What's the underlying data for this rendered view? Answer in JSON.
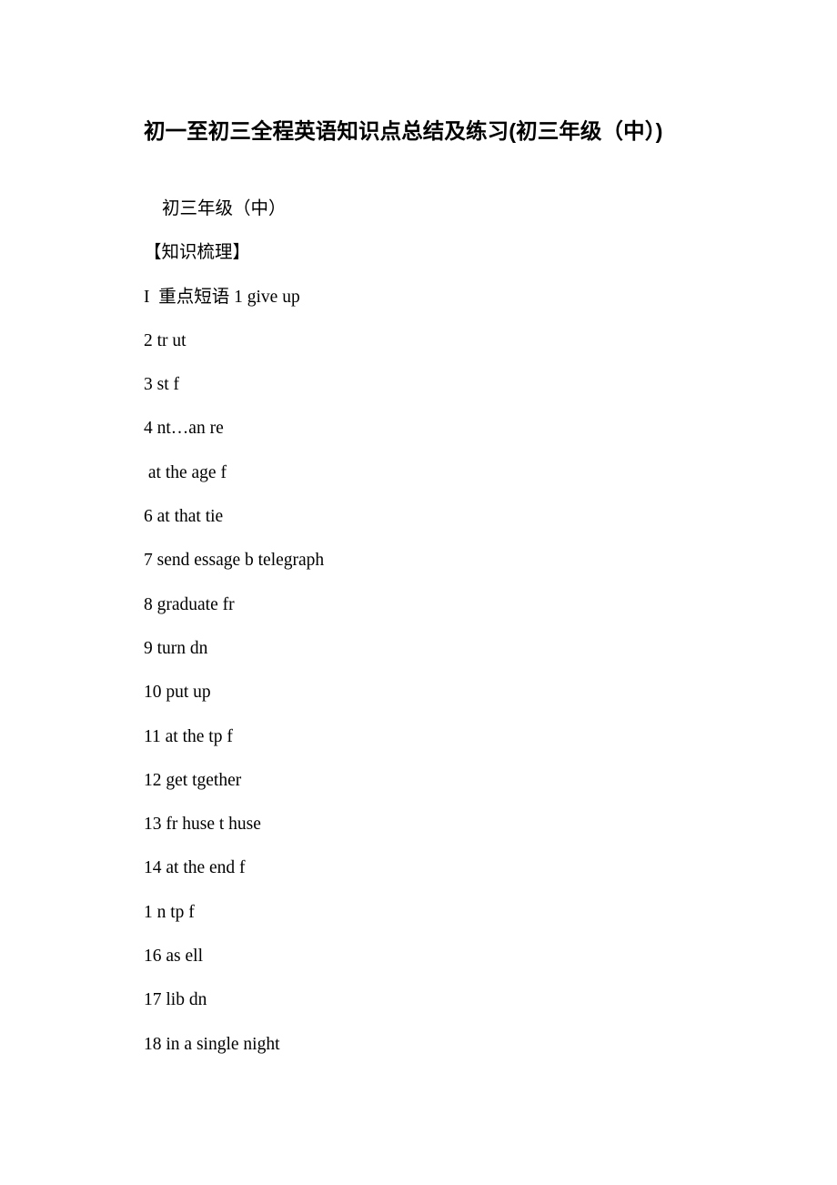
{
  "document": {
    "title": "初一至初三全程英语知识点总结及练习(初三年级（中）)",
    "subtitle": "初三年级（中）",
    "section_heading": "【知识梳理】",
    "lines": [
      "I  重点短语 1 give up",
      "2 tr ut",
      "3 st f",
      "4 nt…an re",
      " at the age f",
      "6 at that tie",
      "7 send essage b telegraph",
      "8 graduate fr",
      "9 turn dn",
      "10 put up",
      "11 at the tp f",
      "12 get tgether",
      "13 fr huse t huse",
      "14 at the end f",
      "1 n tp f",
      "16 as ell",
      "17 lib dn",
      "18 in a single night"
    ]
  },
  "style": {
    "text_color": "#000000",
    "background_color": "#ffffff"
  }
}
